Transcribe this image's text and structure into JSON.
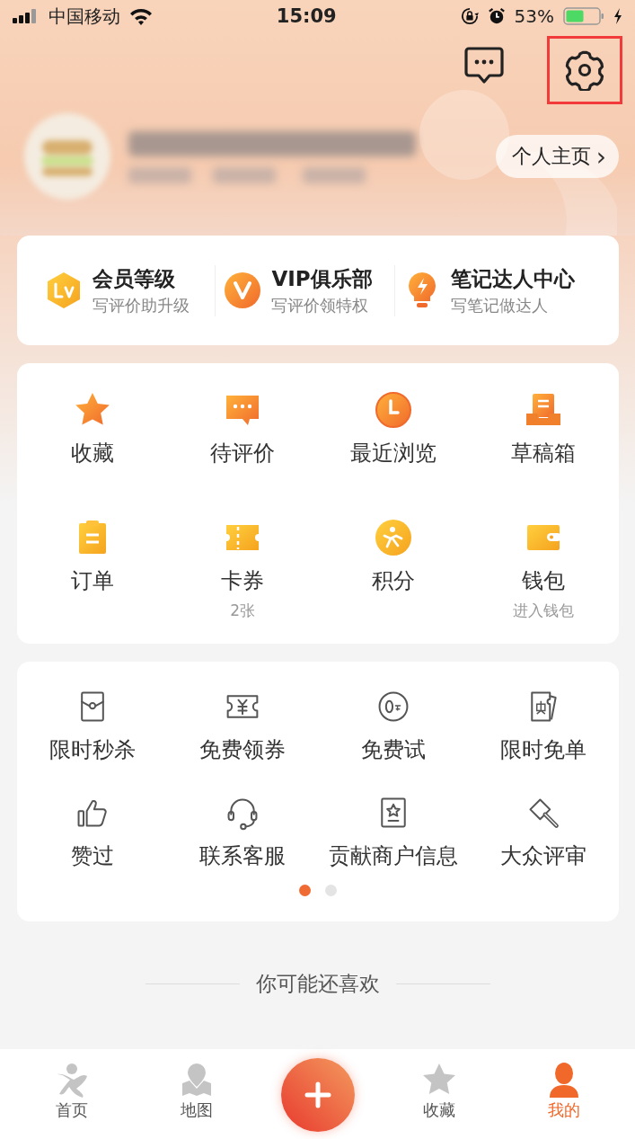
{
  "status_bar": {
    "carrier": "中国移动",
    "time": "15:09",
    "battery": "53%"
  },
  "header": {
    "settings_highlighted": true,
    "profile_button": "个人主页",
    "chevron": "›"
  },
  "member_card": [
    {
      "title": "会员等级",
      "subtitle": "写评价助升级"
    },
    {
      "title": "VIP俱乐部",
      "subtitle": "写评价领特权"
    },
    {
      "title": "笔记达人中心",
      "subtitle": "写笔记做达人"
    }
  ],
  "main_grid": [
    {
      "label": "收藏"
    },
    {
      "label": "待评价"
    },
    {
      "label": "最近浏览"
    },
    {
      "label": "草稿箱"
    },
    {
      "label": "订单"
    },
    {
      "label": "卡券",
      "sub": "2张"
    },
    {
      "label": "积分"
    },
    {
      "label": "钱包",
      "sub": "进入钱包"
    }
  ],
  "service_grid": {
    "items": [
      {
        "label": "限时秒杀"
      },
      {
        "label": "免费领券"
      },
      {
        "label": "免费试"
      },
      {
        "label": "限时免单"
      },
      {
        "label": "赞过"
      },
      {
        "label": "联系客服"
      },
      {
        "label": "贡献商户信息"
      },
      {
        "label": "大众评审"
      }
    ],
    "pages": [
      {
        "selected": true
      },
      {
        "selected": false
      }
    ]
  },
  "recommend_title": "你可能还喜欢",
  "tab_bar": [
    {
      "kind": "tab",
      "label": "首页",
      "selected": false
    },
    {
      "kind": "tab",
      "label": "地图",
      "selected": false
    },
    {
      "kind": "post"
    },
    {
      "kind": "tab",
      "label": "收藏",
      "selected": false
    },
    {
      "kind": "tab",
      "label": "我的",
      "selected": true
    }
  ]
}
